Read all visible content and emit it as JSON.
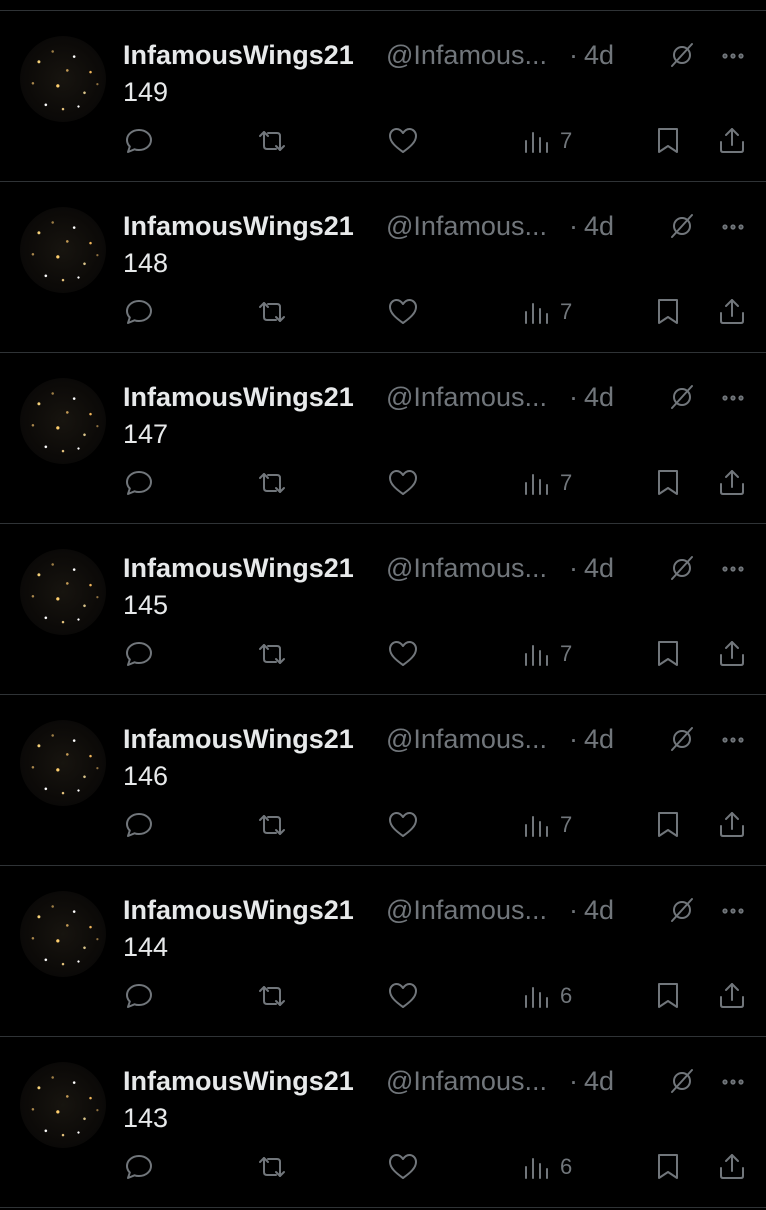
{
  "colors": {
    "background": "#000000",
    "divider": "#2f3336",
    "primary_text": "#e7e9ea",
    "secondary_text": "#71767b"
  },
  "icons": {
    "reply": "reply-icon",
    "repost": "repost-icon",
    "like": "like-icon",
    "views": "views-icon",
    "bookmark": "bookmark-icon",
    "share": "share-icon",
    "grok": "grok-icon",
    "more": "more-icon"
  },
  "tweets": [
    {
      "display_name": "InfamousWings21",
      "handle": "@Infamous...",
      "separator": "·",
      "time": "4d",
      "text": "149",
      "views": "7"
    },
    {
      "display_name": "InfamousWings21",
      "handle": "@Infamous...",
      "separator": "·",
      "time": "4d",
      "text": "148",
      "views": "7"
    },
    {
      "display_name": "InfamousWings21",
      "handle": "@Infamous...",
      "separator": "·",
      "time": "4d",
      "text": "147",
      "views": "7"
    },
    {
      "display_name": "InfamousWings21",
      "handle": "@Infamous...",
      "separator": "·",
      "time": "4d",
      "text": "145",
      "views": "7"
    },
    {
      "display_name": "InfamousWings21",
      "handle": "@Infamous...",
      "separator": "·",
      "time": "4d",
      "text": "146",
      "views": "7"
    },
    {
      "display_name": "InfamousWings21",
      "handle": "@Infamous...",
      "separator": "·",
      "time": "4d",
      "text": "144",
      "views": "6"
    },
    {
      "display_name": "InfamousWings21",
      "handle": "@Infamous...",
      "separator": "·",
      "time": "4d",
      "text": "143",
      "views": "6"
    }
  ]
}
